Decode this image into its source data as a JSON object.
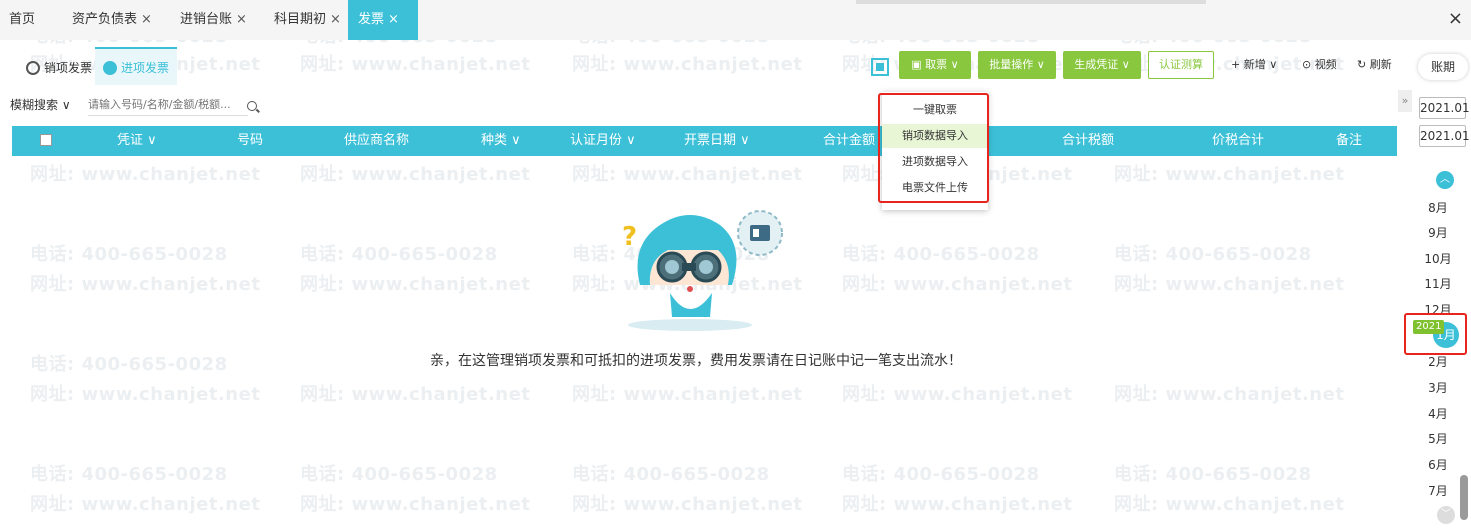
{
  "tabs": [
    {
      "label": "首页",
      "closable": false
    },
    {
      "label": "资产负债表",
      "closable": true
    },
    {
      "label": "进销台账",
      "closable": true
    },
    {
      "label": "科目期初",
      "closable": true
    },
    {
      "label": "发票",
      "closable": true,
      "active": true
    }
  ],
  "close_glyph": "×",
  "window_close": "×",
  "watermark": {
    "phone": "电话: 400-665-0028",
    "web": "网址: www.chanjet.net"
  },
  "subtabs": {
    "sales": "销项发票",
    "purchase": "进项发票"
  },
  "toolbar": {
    "fetch": "取票",
    "batch": "批量操作",
    "voucher": "生成凭证",
    "certify": "认证测算",
    "add": "新增",
    "video": "视频",
    "refresh": "刷新",
    "period": "账期"
  },
  "search": {
    "mode": "模糊搜索",
    "placeholder": "请输入号码/名称/金额/税额..."
  },
  "table_headers": {
    "voucher": "凭证",
    "number": "号码",
    "supplier": "供应商名称",
    "kind": "种类",
    "cert_month": "认证月份",
    "issue_date": "开票日期",
    "total_amount": "合计金额",
    "total_tax": "合计税额",
    "total_with_tax": "价税合计",
    "remark": "备注"
  },
  "empty_message": "亲，在这管理销项发票和可抵扣的进项发票，费用发票请在日记账中记一笔支出流水！",
  "dropdown": [
    "一键取票",
    "销项数据导入",
    "进项数据导入",
    "电票文件上传"
  ],
  "rail": {
    "toggle": "»",
    "year_from": "2021.01",
    "year_to": "2021.01",
    "months_before": [
      "8月",
      "9月",
      "10月",
      "11月",
      "12月"
    ],
    "year_badge": "2021",
    "active_month": "1月",
    "months_after": [
      "2月",
      "3月",
      "4月",
      "5月",
      "6月",
      "7月"
    ]
  },
  "colors": {
    "accent": "#3cc0d8",
    "green": "#89c73e",
    "highlight": "#e8251c"
  }
}
